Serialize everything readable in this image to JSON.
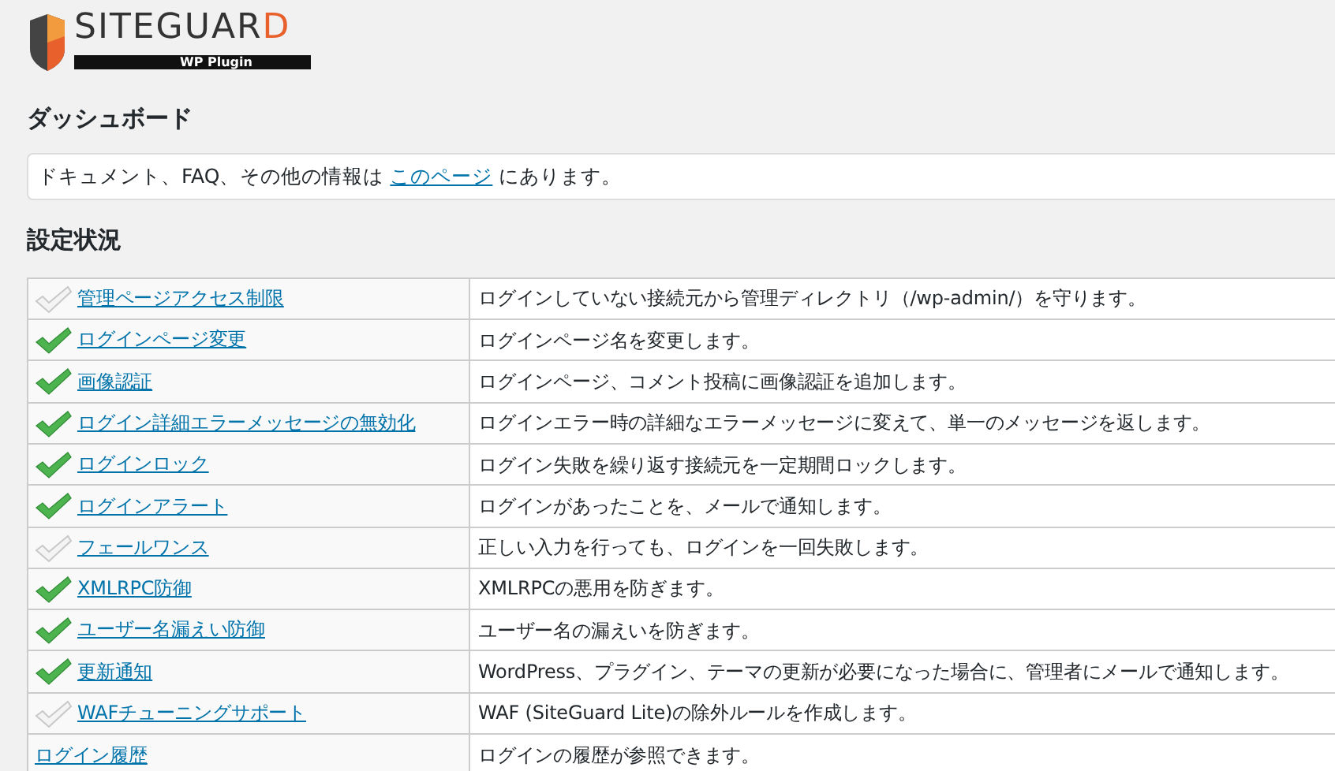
{
  "logo": {
    "name": "SITEGUARD",
    "subtitle": "WP Plugin"
  },
  "page_title": "ダッシュボード",
  "notice": {
    "before": "ドキュメント、FAQ、その他の情報は",
    "link": "このページ",
    "after": "にあります。"
  },
  "section_title": "設定状況",
  "features": [
    {
      "kind": "feature",
      "enabled": false,
      "name": "管理ページアクセス制限",
      "description": "ログインしていない接続元から管理ディレクトリ（/wp-admin/）を守ります。"
    },
    {
      "kind": "feature",
      "enabled": true,
      "name": "ログインページ変更",
      "description": "ログインページ名を変更します。"
    },
    {
      "kind": "feature",
      "enabled": true,
      "name": "画像認証",
      "description": "ログインページ、コメント投稿に画像認証を追加します。"
    },
    {
      "kind": "feature",
      "enabled": true,
      "name": "ログイン詳細エラーメッセージの無効化",
      "description": "ログインエラー時の詳細なエラーメッセージに変えて、単一のメッセージを返します。"
    },
    {
      "kind": "feature",
      "enabled": true,
      "name": "ログインロック",
      "description": "ログイン失敗を繰り返す接続元を一定期間ロックします。"
    },
    {
      "kind": "feature",
      "enabled": true,
      "name": "ログインアラート",
      "description": "ログインがあったことを、メールで通知します。"
    },
    {
      "kind": "feature",
      "enabled": false,
      "name": "フェールワンス",
      "description": "正しい入力を行っても、ログインを一回失敗します。"
    },
    {
      "kind": "feature",
      "enabled": true,
      "name": "XMLRPC防御",
      "description": "XMLRPCの悪用を防ぎます。"
    },
    {
      "kind": "feature",
      "enabled": true,
      "name": "ユーザー名漏えい防御",
      "description": "ユーザー名の漏えいを防ぎます。"
    },
    {
      "kind": "feature",
      "enabled": true,
      "name": "更新通知",
      "description": "WordPress、プラグイン、テーマの更新が必要になった場合に、管理者にメールで通知します。"
    },
    {
      "kind": "feature",
      "enabled": false,
      "name": "WAFチューニングサポート",
      "description": "WAF (SiteGuard Lite)の除外ルールを作成します。"
    },
    {
      "kind": "plain",
      "name": "ログイン履歴",
      "description": "ログインの履歴が参照できます。"
    }
  ]
}
